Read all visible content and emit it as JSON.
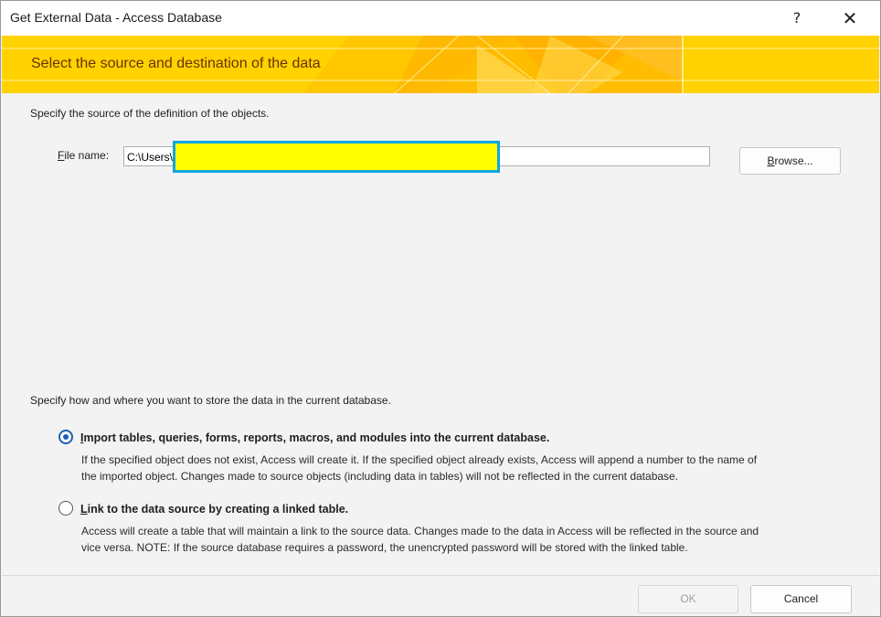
{
  "window": {
    "title": "Get External Data - Access Database",
    "help": "?",
    "close": "✕"
  },
  "banner": {
    "title": "Select the source and destination of the data"
  },
  "source": {
    "instruction": "Specify the source of the definition of the objects.",
    "file_label_prefix": "F",
    "file_label_rest": "ile name:",
    "file_value": "C:\\Users\\",
    "browse_prefix": "B",
    "browse_rest": "rowse..."
  },
  "storage": {
    "instruction": "Specify how and where you want to store the data in the current database.",
    "options": [
      {
        "key": "I",
        "title_rest": "mport tables, queries, forms, reports, macros, and modules into the current database.",
        "desc_line1": "If the specified object does not exist, Access will create it. If the specified object already exists, Access will append a number to the name of",
        "desc_line2": "the imported object. Changes made to source objects (including data in tables) will not be reflected in the current database.",
        "selected": true
      },
      {
        "key": "L",
        "title_rest": "ink to the data source by creating a linked table.",
        "desc_line1": "Access will create a table that will maintain a link to the source data. Changes made to the data in Access will be reflected in the source and",
        "desc_line2": "vice versa. NOTE:  If the source database requires a password, the unencrypted password will be stored with the linked table.",
        "selected": false
      }
    ]
  },
  "footer": {
    "ok": "OK",
    "cancel": "Cancel"
  }
}
